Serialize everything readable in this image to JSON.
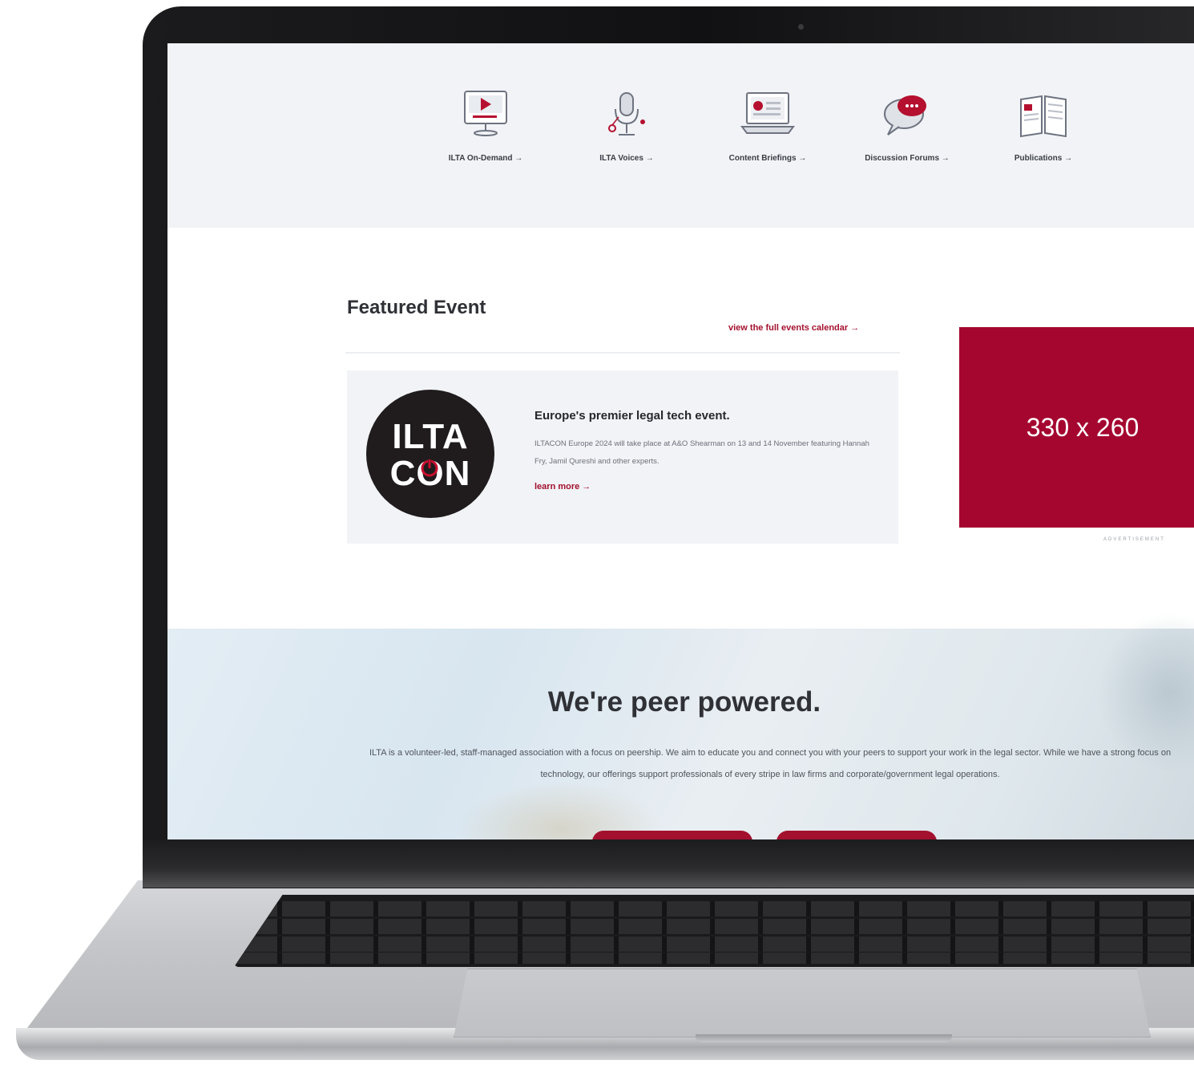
{
  "nav": {
    "items": [
      {
        "label": "ILTA On-Demand →",
        "icon": "video-player-icon"
      },
      {
        "label": "ILTA Voices →",
        "icon": "microphone-icon"
      },
      {
        "label": "Content Briefings →",
        "icon": "laptop-briefing-icon"
      },
      {
        "label": "Discussion Forums →",
        "icon": "chat-bubbles-icon"
      },
      {
        "label": "Publications →",
        "icon": "open-book-icon"
      }
    ]
  },
  "featured": {
    "title": "Featured Event",
    "calendar_link": "view the full events calendar →",
    "event": {
      "logo_line1": "ILTA",
      "logo_line2": "CON",
      "headline": "Europe's premier legal tech event.",
      "description": "ILTACON Europe 2024 will take place at A&O Shearman on 13 and 14 November featuring Hannah Fry, Jamil Qureshi and other experts.",
      "link": "learn more →"
    }
  },
  "ad": {
    "size_label": "330 x 260",
    "caption": "ADVERTISEMENT"
  },
  "peer": {
    "title": "We're peer powered.",
    "body": "ILTA is a volunteer-led, staff-managed association with a focus on peership. We aim to educate you and connect you with your peers to support your work in the legal sector. While we have a strong focus on technology, our offerings support professionals of every stripe in law firms and corporate/government legal operations."
  },
  "colors": {
    "brand": "#a4112f",
    "ad_background": "#a4062f",
    "nav_band": "#f1f3f6"
  }
}
